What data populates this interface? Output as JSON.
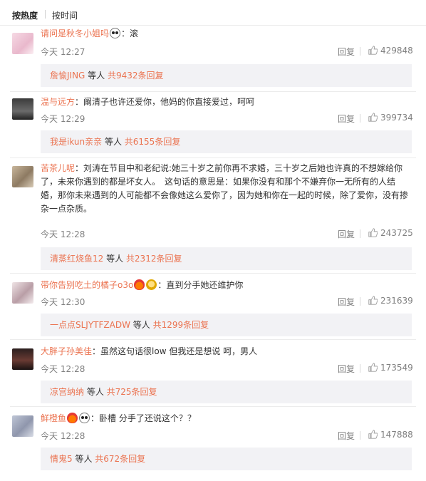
{
  "sort": {
    "hot": "按热度",
    "time": "按时间"
  },
  "comments": [
    {
      "user": "请问是秋冬小姐吗",
      "badges": [
        "panda"
      ],
      "text": "：滚",
      "time": "今天 12:27",
      "reply": "回复",
      "likes": "429848",
      "sub": {
        "name": "詹愉JING",
        "mid": " 等人 ",
        "total": "共9432条回复"
      }
    },
    {
      "user": "温与远方",
      "badges": [],
      "text": "：阚清子也许还爱你，他妈的你直接爱过，呵呵",
      "time": "今天 12:29",
      "reply": "回复",
      "likes": "399734",
      "sub": {
        "name": "我是ikun亲亲",
        "mid": " 等人 ",
        "total": "共6155条回复"
      }
    },
    {
      "user": "苦茶儿呢",
      "badges": [],
      "text": "：刘涛在节目中和老纪说:她三十岁之前你再不求婚，三十岁之后她也许真的不想嫁给你了，未来你遇到的都是坏女人。　这句话的意思是：如果你没有和那个不嫌弃你一无所有的人结婚，那你未来遇到的人可能都不会像她这么爱你了，因为她和你在一起的时候，除了爱你，没有掺杂一点杂质。",
      "time": "今天 12:28",
      "reply": "回复",
      "likes": "243725",
      "sub": {
        "name": "清蒸红烧鱼12",
        "mid": " 等人 ",
        "total": "共2312条回复"
      }
    },
    {
      "user": "带你告别吃土的橘子o3o",
      "badges": [
        "fire",
        "gold"
      ],
      "text": "：直到分手她还维护你",
      "time": "今天 12:30",
      "reply": "回复",
      "likes": "231639",
      "sub": {
        "name": "一点点SLJYTFZADW",
        "mid": " 等人 ",
        "total": "共1299条回复"
      }
    },
    {
      "user": "大胖子孙美佳",
      "badges": [],
      "text": "：虽然这句话很low 但我还是想说 呵，男人",
      "time": "今天 12:28",
      "reply": "回复",
      "likes": "173549",
      "sub": {
        "name": "凉宫纳纳",
        "mid": " 等人 ",
        "total": "共725条回复"
      }
    },
    {
      "user": "鲜橙鱼",
      "badges": [
        "fire",
        "panda"
      ],
      "text": "：卧槽 分手了还说这个？？",
      "time": "今天 12:28",
      "reply": "回复",
      "likes": "147888",
      "sub": {
        "name": "情鬼5",
        "mid": " 等人 ",
        "total": "共672条回复"
      }
    }
  ]
}
